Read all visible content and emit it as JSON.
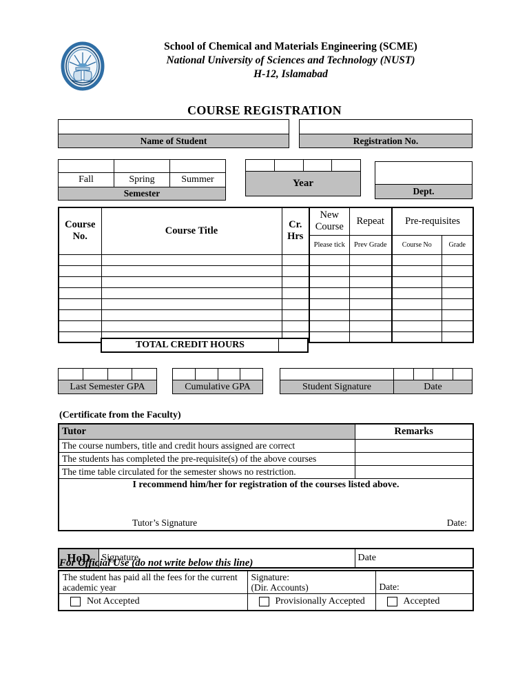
{
  "header": {
    "logo_name": "nust-emblem-logo",
    "org_line1": "School of Chemical and Materials Engineering (SCME)",
    "org_line2": "National University of Sciences and Technology (NUST)",
    "org_line3": "H-12, Islamabad",
    "doc_title": "COURSE REGISTRATION"
  },
  "student": {
    "name_label": "Name of Student",
    "name_value": "",
    "reg_label": "Registration No.",
    "reg_value": ""
  },
  "semester": {
    "label": "Semester",
    "options": [
      "Fall",
      "Spring",
      "Summer"
    ],
    "ticks": [
      "",
      "",
      ""
    ]
  },
  "year": {
    "label": "Year",
    "digits": [
      "",
      "",
      "",
      ""
    ]
  },
  "dept": {
    "label": "Dept.",
    "value": ""
  },
  "course_table": {
    "headers": {
      "course_no": "Course No.",
      "course_title": "Course Title",
      "cr_hrs": "Cr. Hrs",
      "new_course": "New Course",
      "repeat": "Repeat",
      "prerequisites": "Pre-requisites"
    },
    "subheaders": {
      "course_no": "",
      "course_title": "",
      "cr_hrs": "",
      "new_course": "Please tick",
      "repeat": "Prev Grade",
      "prereq_course_no": "Course No",
      "prereq_grade": "Grade"
    },
    "rows": [
      {
        "course_no": "",
        "course_title": "",
        "cr_hrs": "",
        "new_course": "",
        "repeat": "",
        "prereq_course_no": "",
        "prereq_grade": ""
      },
      {
        "course_no": "",
        "course_title": "",
        "cr_hrs": "",
        "new_course": "",
        "repeat": "",
        "prereq_course_no": "",
        "prereq_grade": ""
      },
      {
        "course_no": "",
        "course_title": "",
        "cr_hrs": "",
        "new_course": "",
        "repeat": "",
        "prereq_course_no": "",
        "prereq_grade": ""
      },
      {
        "course_no": "",
        "course_title": "",
        "cr_hrs": "",
        "new_course": "",
        "repeat": "",
        "prereq_course_no": "",
        "prereq_grade": ""
      },
      {
        "course_no": "",
        "course_title": "",
        "cr_hrs": "",
        "new_course": "",
        "repeat": "",
        "prereq_course_no": "",
        "prereq_grade": ""
      },
      {
        "course_no": "",
        "course_title": "",
        "cr_hrs": "",
        "new_course": "",
        "repeat": "",
        "prereq_course_no": "",
        "prereq_grade": ""
      },
      {
        "course_no": "",
        "course_title": "",
        "cr_hrs": "",
        "new_course": "",
        "repeat": "",
        "prereq_course_no": "",
        "prereq_grade": ""
      },
      {
        "course_no": "",
        "course_title": "",
        "cr_hrs": "",
        "new_course": "",
        "repeat": "",
        "prereq_course_no": "",
        "prereq_grade": ""
      }
    ],
    "total_label": "TOTAL CREDIT HOURS",
    "total_value": ""
  },
  "gpa": {
    "last_semester_label": "Last Semester GPA",
    "last_semester_digits": [
      "",
      "",
      "",
      ""
    ],
    "cumulative_label": "Cumulative GPA",
    "cumulative_digits": [
      "",
      "",
      "",
      ""
    ]
  },
  "student_sign": {
    "signature_label": "Student Signature",
    "signature_value": "",
    "date_label": "Date",
    "date_digits": [
      "",
      "",
      "",
      ""
    ]
  },
  "certificate": {
    "title": "(Certificate from the Faculty)",
    "tutor_header": "Tutor",
    "remarks_header": "Remarks",
    "statements": [
      "The course numbers, title and credit hours assigned are correct",
      "The students has completed the pre-requisite(s) of the above courses",
      "The time table circulated for the semester shows no restriction."
    ],
    "remarks": [
      "",
      "",
      ""
    ],
    "recommend_text": "I recommend him/her for registration of the courses listed above.",
    "tutor_signature_label": "Tutor’s Signature",
    "tutor_date_label": "Date:",
    "hod_label": "HoD",
    "hod_signature_label": "Signature",
    "hod_date_label": "Date"
  },
  "official": {
    "title": "For Official Use (do not write below this line)",
    "fees_text": "The student has paid all the fees for the current academic year",
    "signature_label": "Signature:",
    "signature_sub": "(Dir. Accounts)",
    "date_label": "Date:",
    "checkboxes": [
      {
        "label": "Not Accepted",
        "checked": false
      },
      {
        "label": "Provisionally Accepted",
        "checked": false
      },
      {
        "label": "Accepted",
        "checked": false
      }
    ]
  },
  "colors": {
    "shade": "#c0c0c0",
    "logo_blue": "#2f6ea5",
    "logo_dark": "#1c4c78",
    "border": "#000000"
  }
}
